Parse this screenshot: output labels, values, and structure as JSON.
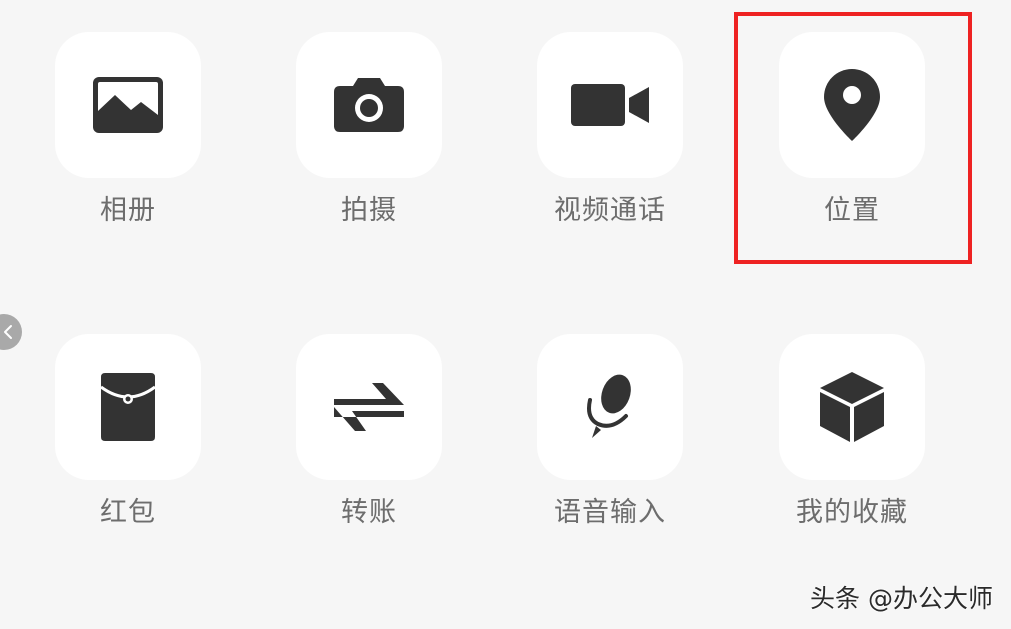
{
  "panel": {
    "items": [
      {
        "label": "相册",
        "icon": "photo-album-icon"
      },
      {
        "label": "拍摄",
        "icon": "camera-icon"
      },
      {
        "label": "视频通话",
        "icon": "video-camera-icon"
      },
      {
        "label": "位置",
        "icon": "location-pin-icon"
      },
      {
        "label": "红包",
        "icon": "red-envelope-icon"
      },
      {
        "label": "转账",
        "icon": "transfer-arrows-icon"
      },
      {
        "label": "语音输入",
        "icon": "microphone-icon"
      },
      {
        "label": "我的收藏",
        "icon": "favorites-cube-icon"
      }
    ],
    "highlighted_item": "位置"
  },
  "watermark": {
    "text": "头条 @办公大师"
  },
  "colors": {
    "background": "#f6f6f6",
    "tile": "#ffffff",
    "icon": "#333333",
    "label": "#6d6d6d",
    "highlight_border": "#ee2222",
    "back_handle": "#a9a9a9"
  }
}
